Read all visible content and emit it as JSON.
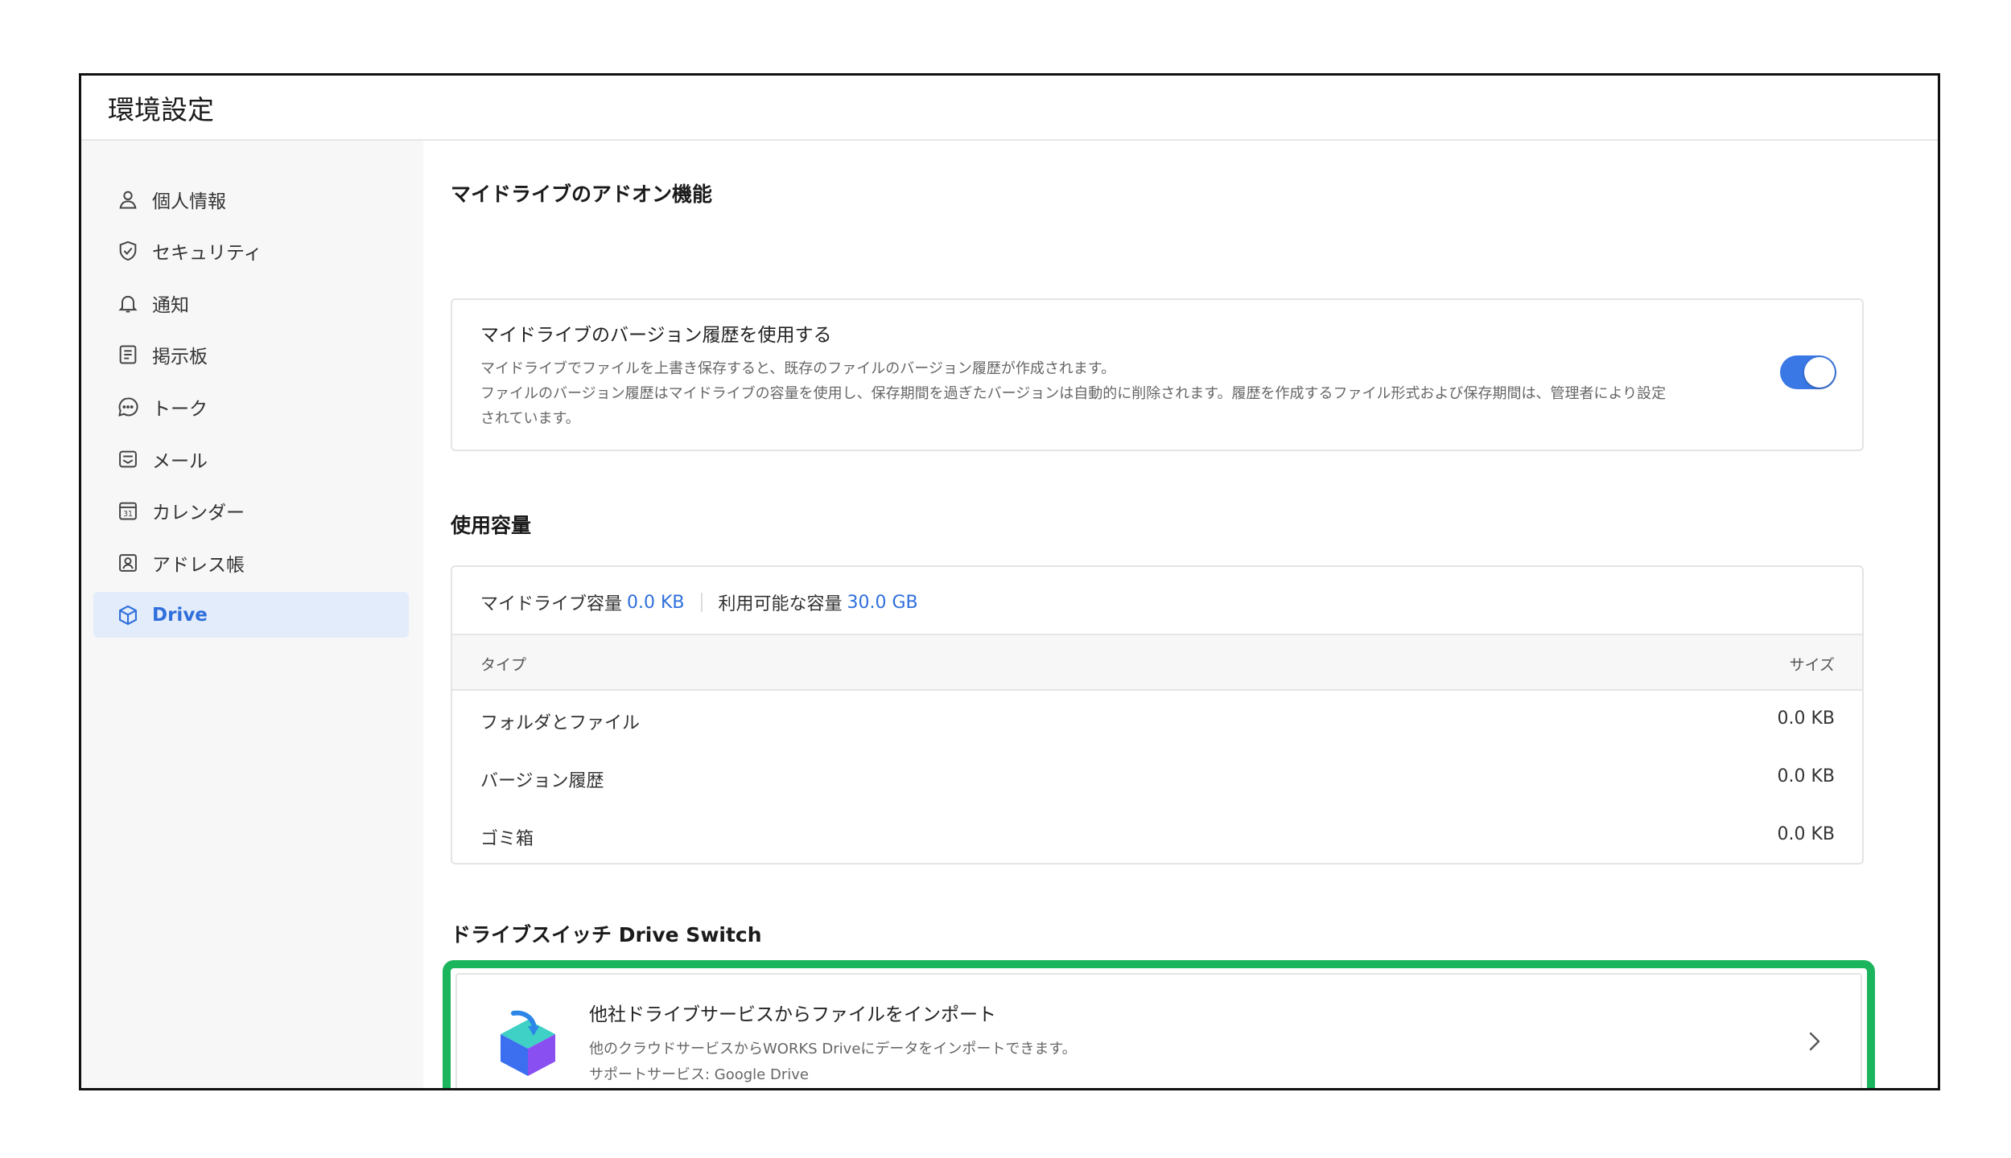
{
  "window": {
    "title": "環境設定"
  },
  "sidebar": {
    "items": [
      {
        "label": "個人情報",
        "icon": "person-icon"
      },
      {
        "label": "セキュリティ",
        "icon": "shield-check-icon"
      },
      {
        "label": "通知",
        "icon": "bell-icon"
      },
      {
        "label": "掲示板",
        "icon": "board-icon"
      },
      {
        "label": "トーク",
        "icon": "chat-bubble-icon"
      },
      {
        "label": "メール",
        "icon": "mail-icon"
      },
      {
        "label": "カレンダー",
        "icon": "calendar-icon"
      },
      {
        "label": "アドレス帳",
        "icon": "address-book-icon"
      },
      {
        "label": "Drive",
        "icon": "cube-icon",
        "active": true
      }
    ],
    "calendar_icon_text": "31"
  },
  "addon": {
    "section_title": "マイドライブのアドオン機能",
    "setting_title": "マイドライブのバージョン履歴を使用する",
    "desc_line1": "マイドライブでファイルを上書き保存すると、既存のファイルのバージョン履歴が作成されます。",
    "desc_line2": "ファイルのバージョン履歴はマイドライブの容量を使用し、保存期間を過ぎたバージョンは自動的に削除されます。履歴を作成するファイル形式および保存期間は、管理者により設定",
    "desc_line3": "されています。",
    "toggle_on": true
  },
  "usage": {
    "section_title": "使用容量",
    "my_drive_label": "マイドライブ容量",
    "my_drive_value": "0.0 KB",
    "available_label": "利用可能な容量",
    "available_value": "30.0 GB",
    "columns": {
      "type": "タイプ",
      "size": "サイズ"
    },
    "rows": [
      {
        "type": "フォルダとファイル",
        "size": "0.0 KB"
      },
      {
        "type": "バージョン履歴",
        "size": "0.0 KB"
      },
      {
        "type": "ゴミ箱",
        "size": "0.0 KB"
      }
    ]
  },
  "drive_switch": {
    "section_title": "ドライブスイッチ Drive Switch",
    "card_title": "他社ドライブサービスからファイルをインポート",
    "card_desc": "他のクラウドサービスからWORKS Driveにデータをインポートできます。",
    "card_support": "サポートサービス: Google Drive"
  },
  "colors": {
    "accent": "#2f6fdc",
    "highlight": "#1ab55c",
    "toggle": "#3a78e6"
  }
}
